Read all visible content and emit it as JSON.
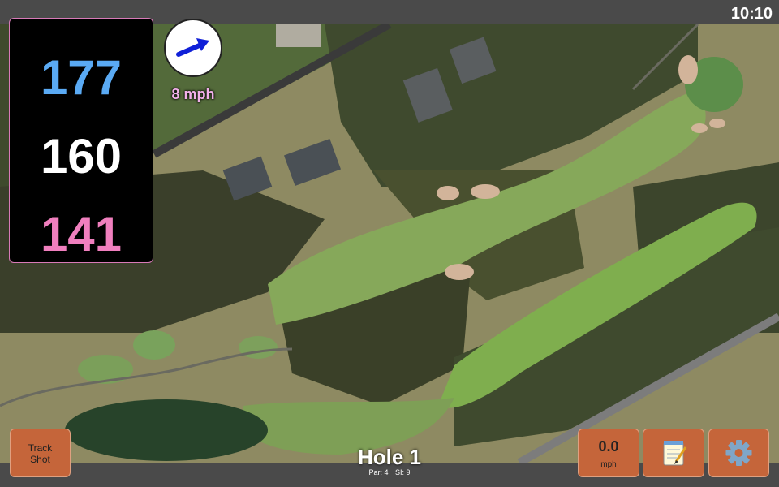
{
  "status": {
    "time": "10:10"
  },
  "distances": {
    "back": "177",
    "middle": "160",
    "front": "141"
  },
  "wind": {
    "speed_label": "8 mph",
    "direction_icon": "arrow-icon"
  },
  "hole": {
    "title": "Hole 1",
    "par_label": "Par: 4",
    "si_label": "SI: 9"
  },
  "buttons": {
    "track_shot_line1": "Track",
    "track_shot_line2": "Shot",
    "speed_value": "0.0",
    "speed_unit": "mph",
    "notes_icon": "notepad-icon",
    "settings_icon": "gear-icon"
  },
  "colors": {
    "back": "#5aaaf4",
    "middle": "#ffffff",
    "front": "#f07fbe",
    "wind_text": "#f2b0ea",
    "button": "#c5653a"
  }
}
